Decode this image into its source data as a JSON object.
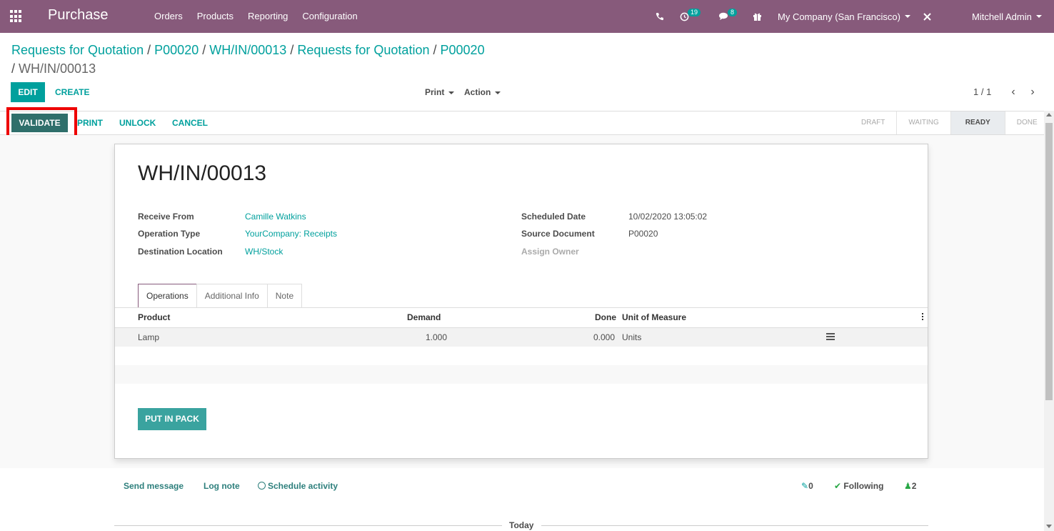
{
  "navbar": {
    "app_name": "Purchase",
    "menu": [
      "Orders",
      "Products",
      "Reporting",
      "Configuration"
    ],
    "activity_count": "19",
    "message_count": "8",
    "company": "My Company (San Francisco)",
    "user": "Mitchell Admin"
  },
  "breadcrumb": {
    "items": [
      "Requests for Quotation",
      "P00020",
      "WH/IN/00013",
      "Requests for Quotation",
      "P00020"
    ],
    "current": "WH/IN/00013",
    "separator": "/"
  },
  "control_panel": {
    "edit_label": "EDIT",
    "create_label": "CREATE",
    "print_label": "Print",
    "action_label": "Action",
    "pager_value": "1 / 1"
  },
  "statusbar": {
    "validate_label": "VALIDATE",
    "print_label": "PRINT",
    "unlock_label": "UNLOCK",
    "cancel_label": "CANCEL",
    "stages": [
      "DRAFT",
      "WAITING",
      "READY",
      "DONE"
    ],
    "current_stage": "READY"
  },
  "form": {
    "title": "WH/IN/00013",
    "left_fields": [
      {
        "label": "Receive From",
        "value": "Camille Watkins"
      },
      {
        "label": "Operation Type",
        "value": "YourCompany: Receipts"
      },
      {
        "label": "Destination Location",
        "value": "WH/Stock"
      }
    ],
    "right_fields": [
      {
        "label": "Scheduled Date",
        "value": "10/02/2020 13:05:02"
      },
      {
        "label": "Source Document",
        "value": "P00020"
      },
      {
        "label": "Assign Owner",
        "value": ""
      }
    ],
    "tabs": [
      "Operations",
      "Additional Info",
      "Note"
    ],
    "active_tab": "Operations",
    "table": {
      "columns": [
        "Product",
        "Demand",
        "Done",
        "Unit of Measure"
      ],
      "rows": [
        {
          "product": "Lamp",
          "demand": "1.000",
          "done": "0.000",
          "uom": "Units"
        }
      ]
    },
    "put_in_pack_label": "PUT IN PACK"
  },
  "chatter": {
    "send_message": "Send message",
    "log_note": "Log note",
    "schedule_activity": "Schedule activity",
    "attachments_count": "0",
    "following_label": "Following",
    "followers_count": "2",
    "today_label": "Today"
  },
  "colors": {
    "brand": "#875a7b",
    "accent": "#00a09d",
    "validate": "#2f6f6b",
    "highlight": "#ee0000"
  }
}
